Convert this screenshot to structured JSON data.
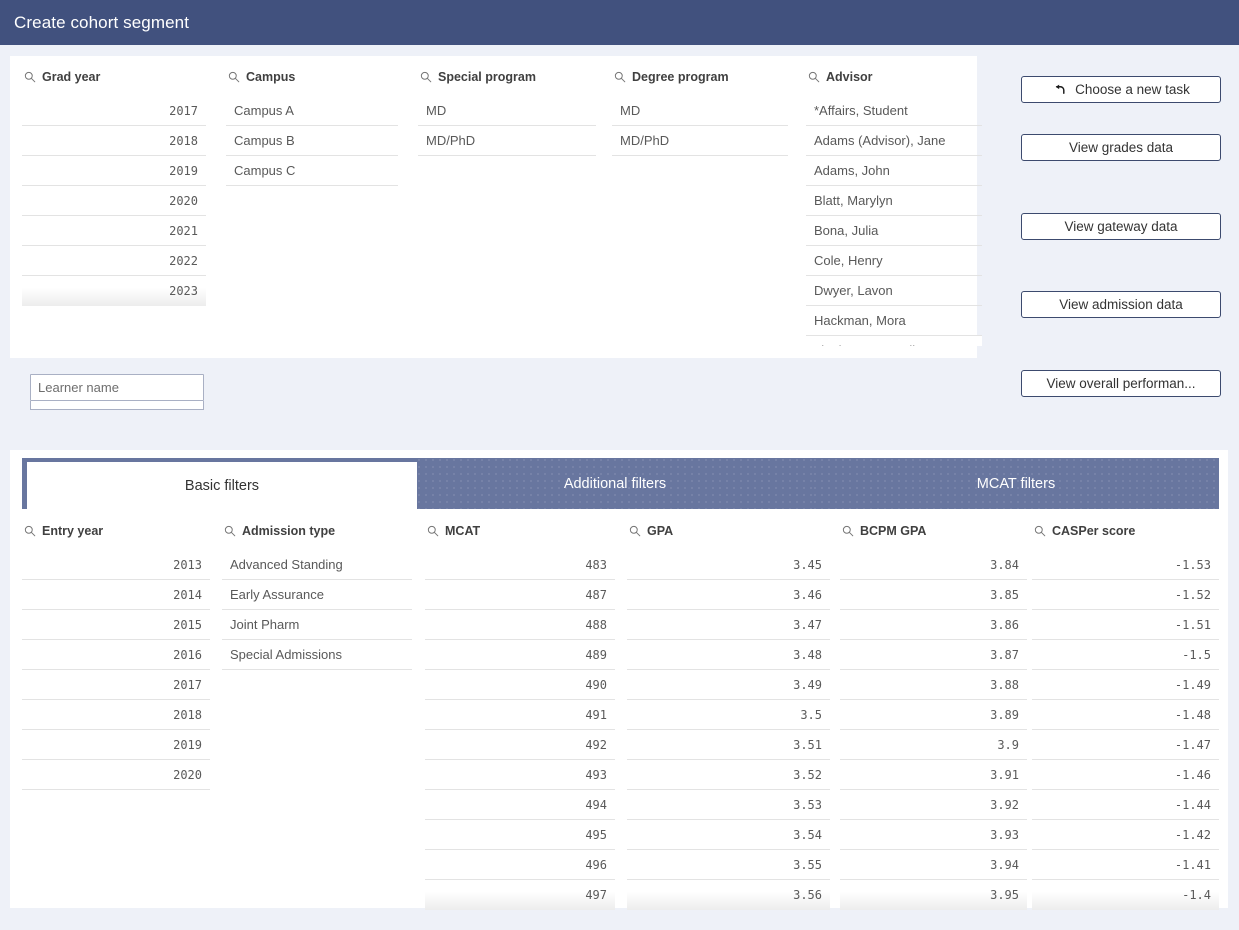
{
  "window": {
    "title": "Create cohort segment",
    "header_color": "#41517e",
    "page_background": "#eef1f8",
    "tab_inactive_color": "#68769f"
  },
  "top_panel": {
    "listboxes": [
      {
        "name": "grad-year",
        "title": "Grad year",
        "align": "num",
        "items": [
          "2017",
          "2018",
          "2019",
          "2020",
          "2021",
          "2022",
          "2023"
        ],
        "last_partial": true
      },
      {
        "name": "campus",
        "title": "Campus",
        "align": "text",
        "items": [
          "Campus A",
          "Campus B",
          "Campus C"
        ],
        "last_partial": false
      },
      {
        "name": "special-program",
        "title": "Special program",
        "align": "text",
        "items": [
          "MD",
          "MD/PhD"
        ],
        "last_partial": false
      },
      {
        "name": "degree-program",
        "title": "Degree program",
        "align": "text",
        "items": [
          "MD",
          "MD/PhD"
        ],
        "last_partial": false
      },
      {
        "name": "advisor",
        "title": "Advisor",
        "align": "text",
        "items": [
          "*Affairs, Student",
          "Adams (Advisor), Jane",
          "Adams, John",
          "Blatt, Marylyn",
          "Bona, Julia",
          "Cole, Henry",
          "Dwyer, Lavon",
          "Hackman, Mora",
          "Lineberger, Jessika"
        ],
        "last_partial": true
      }
    ],
    "learner_name_input": {
      "placeholder": "Learner name",
      "value": ""
    }
  },
  "actions": {
    "buttons": [
      {
        "name": "choose-new-task",
        "label": "Choose a new task",
        "icon": "back-arrow-icon"
      },
      {
        "name": "view-grades-data",
        "label": "View grades data",
        "icon": ""
      },
      {
        "name": "view-gateway-data",
        "label": "View gateway data",
        "icon": ""
      },
      {
        "name": "view-admission-data",
        "label": "View admission data",
        "icon": ""
      },
      {
        "name": "view-overall-performance",
        "label": "View overall performan...",
        "icon": ""
      }
    ]
  },
  "bottom_panel": {
    "tabs": [
      {
        "name": "basic-filters",
        "label": "Basic filters",
        "active": true
      },
      {
        "name": "additional-filters",
        "label": "Additional filters",
        "active": false
      },
      {
        "name": "mcat-filters",
        "label": "MCAT filters",
        "active": false
      }
    ],
    "listboxes": [
      {
        "name": "entry-year",
        "title": "Entry year",
        "align": "num",
        "items": [
          "2013",
          "2014",
          "2015",
          "2016",
          "2017",
          "2018",
          "2019",
          "2020"
        ],
        "last_partial": false
      },
      {
        "name": "admission-type",
        "title": "Admission type",
        "align": "text",
        "items": [
          "Advanced Standing",
          "Early Assurance",
          "Joint Pharm",
          "Special Admissions"
        ],
        "last_partial": false
      },
      {
        "name": "mcat",
        "title": "MCAT",
        "align": "num",
        "items": [
          "483",
          "487",
          "488",
          "489",
          "490",
          "491",
          "492",
          "493",
          "494",
          "495",
          "496",
          "497"
        ],
        "last_partial": true
      },
      {
        "name": "gpa",
        "title": "GPA",
        "align": "num",
        "items": [
          "3.45",
          "3.46",
          "3.47",
          "3.48",
          "3.49",
          "3.5",
          "3.51",
          "3.52",
          "3.53",
          "3.54",
          "3.55",
          "3.56"
        ],
        "last_partial": true
      },
      {
        "name": "bcpm-gpa",
        "title": "BCPM GPA",
        "align": "num",
        "items": [
          "3.84",
          "3.85",
          "3.86",
          "3.87",
          "3.88",
          "3.89",
          "3.9",
          "3.91",
          "3.92",
          "3.93",
          "3.94",
          "3.95"
        ],
        "last_partial": true
      },
      {
        "name": "casper-score",
        "title": "CASPer score",
        "align": "num",
        "items": [
          "-1.53",
          "-1.52",
          "-1.51",
          "-1.5",
          "-1.49",
          "-1.48",
          "-1.47",
          "-1.46",
          "-1.44",
          "-1.42",
          "-1.41",
          "-1.4"
        ],
        "last_partial": true
      }
    ]
  }
}
